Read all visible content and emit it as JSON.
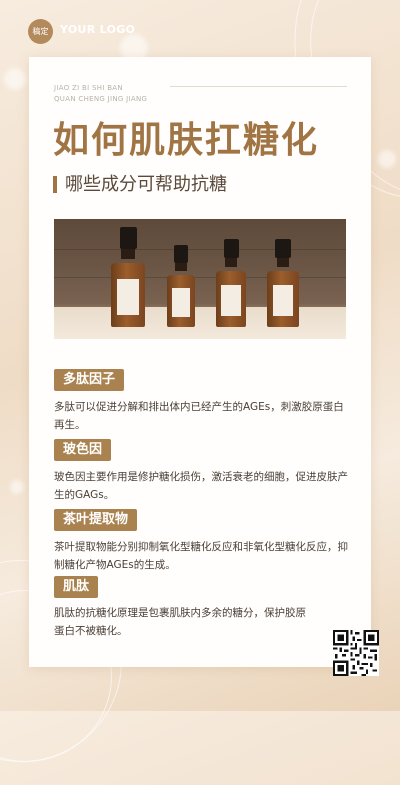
{
  "logo": {
    "badge": "稿定",
    "text": "YOUR LOGO"
  },
  "header": {
    "pinyin_line1": "JIAO ZI BI SHI BAN",
    "pinyin_line2": "QUAN CHENG JING JIANG"
  },
  "title": "如何肌肤扛糖化",
  "subtitle": "哪些成分可帮助抗糖",
  "sections": [
    {
      "tag": "多肽因子",
      "text": "多肽可以促进分解和排出体内已经产生的AGEs，刺激胶原蛋白再生。"
    },
    {
      "tag": "玻色因",
      "text": "玻色因主要作用是修护糖化损伤，激活衰老的细胞，促进皮肤产生的GAGs。"
    },
    {
      "tag": "茶叶提取物",
      "text": "茶叶提取物能分别抑制氧化型糖化反应和非氧化型糖化反应，抑制糖化产物AGEs的生成。"
    },
    {
      "tag": "肌肽",
      "text": "肌肽的抗糖化原理是包裹肌肤内多余的糖分，保护胶原蛋白不被糖化。"
    }
  ],
  "colors": {
    "accent": "#a07443",
    "tag_bg": "#a9824f",
    "background": "#f2e3d2"
  },
  "icons": {
    "qr": "qr-code-icon",
    "photo": "serum-bottles-photo"
  }
}
